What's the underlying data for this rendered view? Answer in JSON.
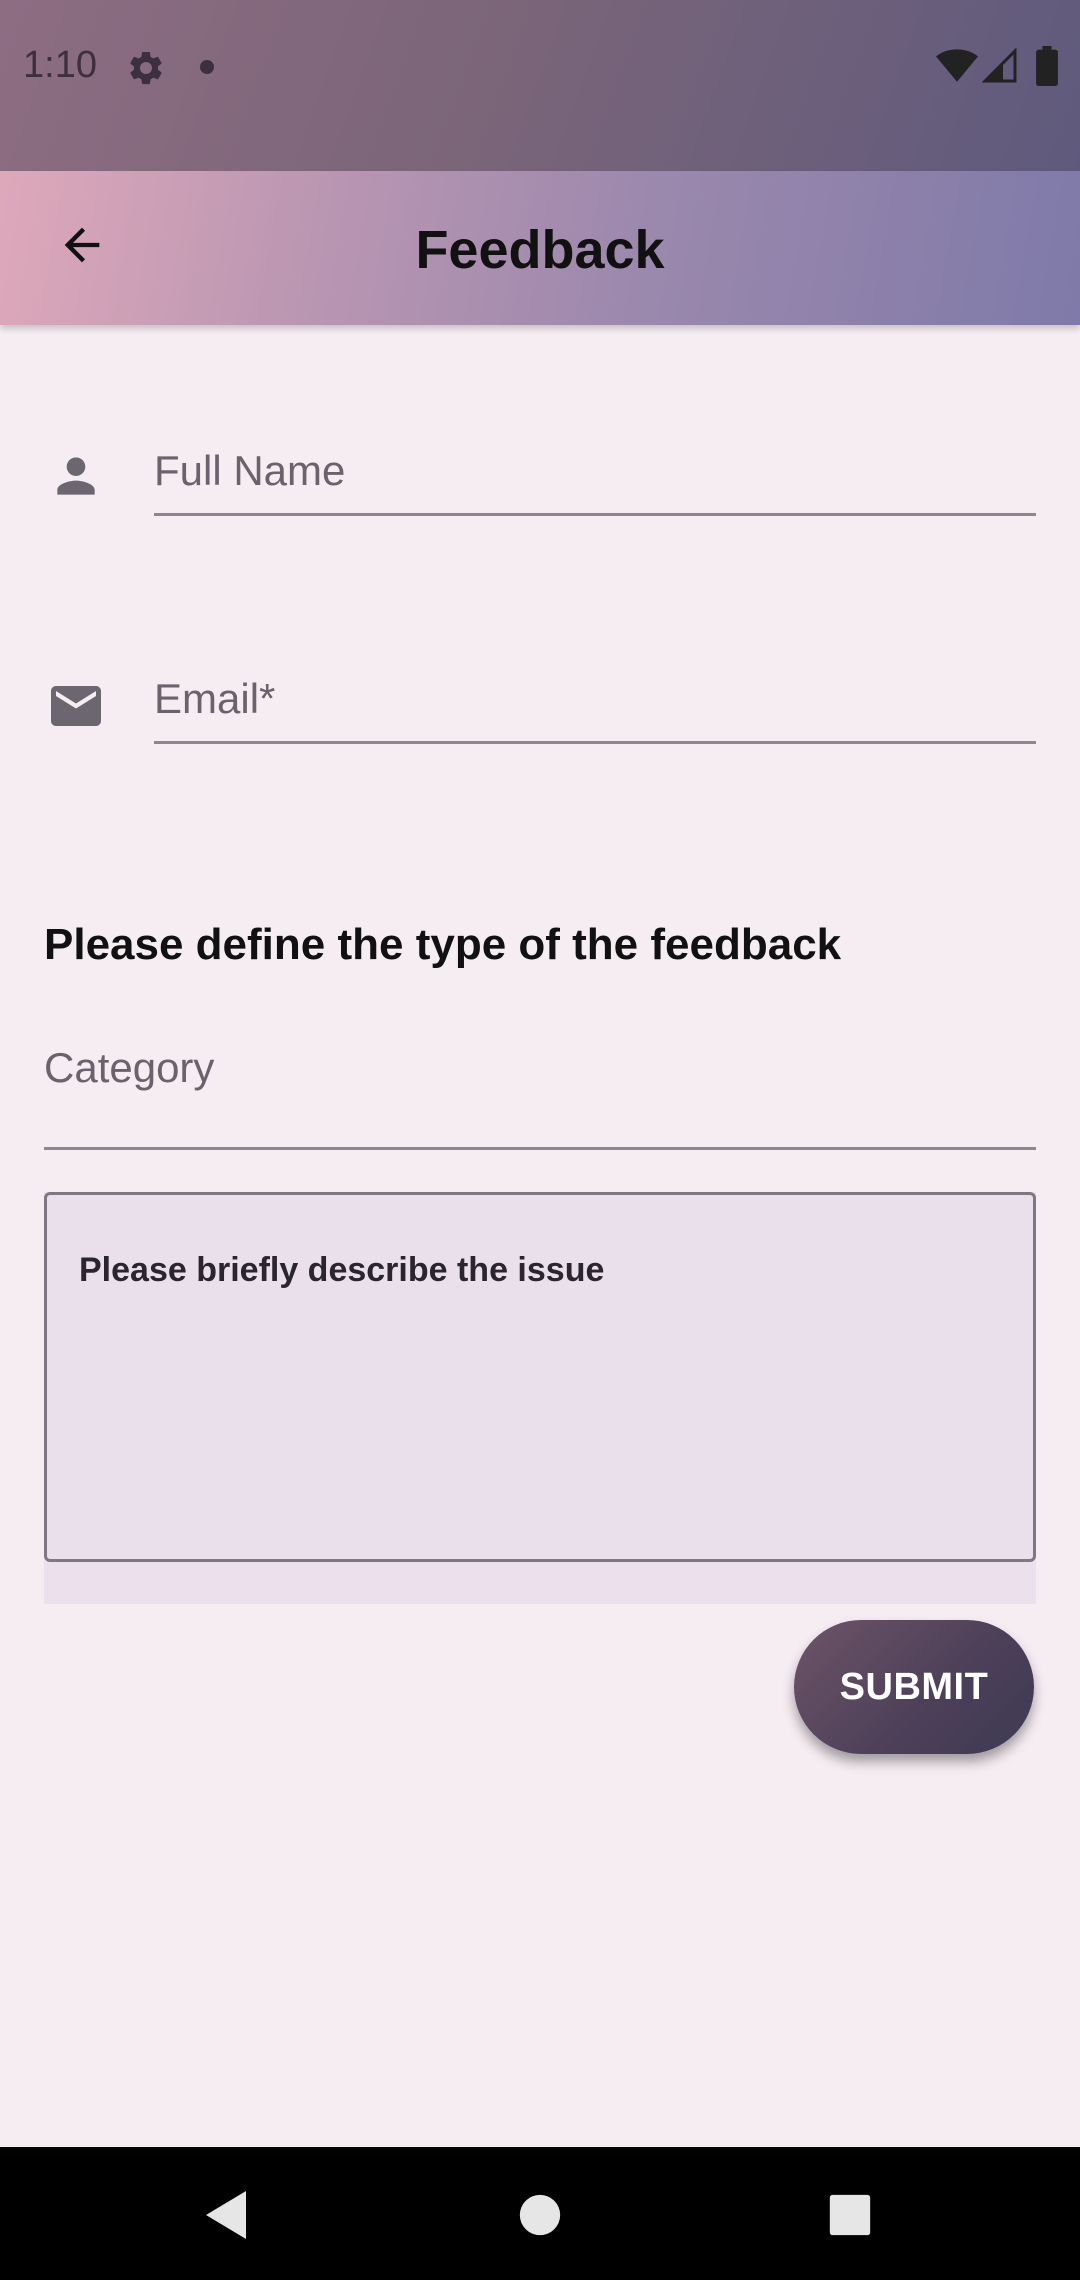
{
  "status_bar": {
    "time": "1:10",
    "icons": [
      "gear-icon",
      "notification-dot-icon",
      "wifi-icon",
      "signal-icon",
      "battery-icon"
    ]
  },
  "app_bar": {
    "title": "Feedback",
    "back_icon": "arrow-left-icon"
  },
  "form": {
    "full_name": {
      "icon": "person-icon",
      "placeholder": "Full Name",
      "value": ""
    },
    "email": {
      "icon": "envelope-icon",
      "placeholder": "Email*",
      "value": ""
    },
    "section_heading": "Please define the type of the feedback",
    "category": {
      "label": "Category",
      "selected": ""
    },
    "issue": {
      "placeholder": "Please briefly describe the issue",
      "value": ""
    },
    "submit_label": "SUBMIT"
  },
  "nav_bar": {
    "icons": [
      "back-triangle-icon",
      "home-circle-icon",
      "recents-square-icon"
    ]
  },
  "colors": {
    "background": "#f6edf3",
    "submit_button": "#4c3f58",
    "underline": "#8e8690"
  }
}
